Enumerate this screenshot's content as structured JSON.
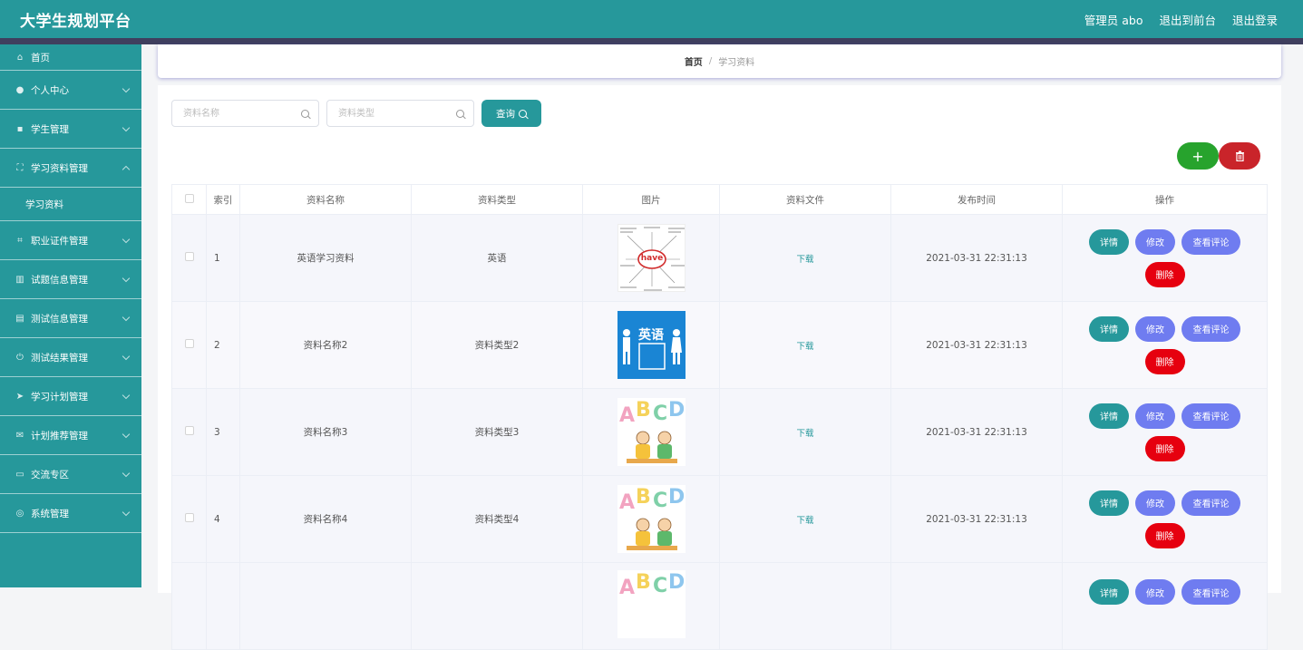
{
  "header": {
    "title": "大学生规划平台",
    "admin": "管理员 abo",
    "back_front": "退出到前台",
    "logout": "退出登录"
  },
  "sidebar": {
    "home": "首页",
    "items": [
      {
        "label": "个人中心"
      },
      {
        "label": "学生管理"
      },
      {
        "label": "学习资料管理"
      },
      {
        "label": "职业证件管理"
      },
      {
        "label": "试题信息管理"
      },
      {
        "label": "测试信息管理"
      },
      {
        "label": "测试结果管理"
      },
      {
        "label": "学习计划管理"
      },
      {
        "label": "计划推荐管理"
      },
      {
        "label": "交流专区"
      },
      {
        "label": "系统管理"
      }
    ],
    "subitem": "学习资料"
  },
  "breadcrumb": {
    "home": "首页",
    "sep": "/",
    "current": "学习资料"
  },
  "search": {
    "name_placeholder": "资料名称",
    "type_placeholder": "资料类型",
    "query_label": "查询"
  },
  "table": {
    "headers": [
      "索引",
      "资料名称",
      "资料类型",
      "图片",
      "资料文件",
      "发布时间",
      "操作"
    ],
    "rows": [
      {
        "index": "1",
        "name": "英语学习资料",
        "type": "英语",
        "file": "下载",
        "time": "2021-03-31 22:31:13"
      },
      {
        "index": "2",
        "name": "资料名称2",
        "type": "资料类型2",
        "file": "下载",
        "time": "2021-03-31 22:31:13"
      },
      {
        "index": "3",
        "name": "资料名称3",
        "type": "资料类型3",
        "file": "下载",
        "time": "2021-03-31 22:31:13"
      },
      {
        "index": "4",
        "name": "资料名称4",
        "type": "资料类型4",
        "file": "下载",
        "time": "2021-03-31 22:31:13"
      }
    ],
    "ops": {
      "detail": "详情",
      "edit": "修改",
      "comment": "查看评论",
      "delete": "删除"
    }
  },
  "thumb_text": {
    "have": "have",
    "english": "英语"
  },
  "colors": {
    "teal": "#26989b",
    "purple": "#6f7cf0",
    "red": "#e6000f",
    "green": "#27a32d",
    "dark_red": "#c9242a"
  }
}
